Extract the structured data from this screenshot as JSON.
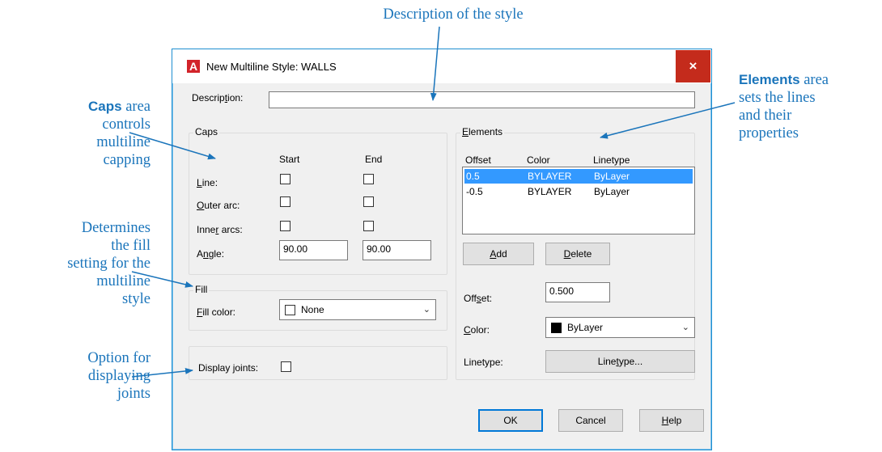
{
  "annotations": {
    "top": "Description of the style",
    "caps_bold": "Caps",
    "caps_rest_1": " area",
    "caps_rest_2": "controls",
    "caps_rest_3": "multiline",
    "caps_rest_4": "capping",
    "fill_1": "Determines",
    "fill_2": "the fill",
    "fill_3": "setting for the",
    "fill_4": "multiline",
    "fill_5": "style",
    "joints_1": "Option for",
    "joints_2": "displaying",
    "joints_3": "joints",
    "elements_bold": "Elements",
    "elements_rest_1": " area",
    "elements_rest_2": "sets the lines",
    "elements_rest_3": "and their",
    "elements_rest_4": "properties"
  },
  "dialog": {
    "title": "New Multiline Style: WALLS",
    "app_icon": "A",
    "close_label": "×",
    "description_label_pre": "Descrip",
    "description_label_u": "t",
    "description_label_post": "ion:",
    "description_value": "",
    "caps": {
      "title": "Caps",
      "col_start": "Start",
      "col_end": "End",
      "line_u": "L",
      "line_rest": "ine:",
      "outer_u": "O",
      "outer_rest": "uter arc:",
      "inner_pre": "Inne",
      "inner_u": "r",
      "inner_post": " arcs:",
      "angle_pre": "A",
      "angle_u": "n",
      "angle_post": "gle:",
      "angle_start": "90.00",
      "angle_end": "90.00"
    },
    "fill": {
      "title": "Fill",
      "color_u": "F",
      "color_rest": "ill color:",
      "color_value": "None"
    },
    "joints_pre": "Display ",
    "joints_u": "j",
    "joints_post": "oints:",
    "elements": {
      "title_u": "E",
      "title_rest": "lements",
      "headers": [
        "Offset",
        "Color",
        "Linetype"
      ],
      "rows": [
        {
          "offset": "0.5",
          "color": "BYLAYER",
          "linetype": "ByLayer"
        },
        {
          "offset": "-0.5",
          "color": "BYLAYER",
          "linetype": "ByLayer"
        }
      ],
      "add_u": "A",
      "add_rest": "dd",
      "delete_u": "D",
      "delete_rest": "elete",
      "offset_pre": "Off",
      "offset_u": "s",
      "offset_post": "et:",
      "offset_value": "0.500",
      "color_u": "C",
      "color_rest": "olor:",
      "color_value": "ByLayer",
      "linetype_label": "Linetype:",
      "linetype_btn_pre": "Line",
      "linetype_btn_u": "t",
      "linetype_btn_post": "ype..."
    },
    "ok": "OK",
    "cancel": "Cancel",
    "help_u": "H",
    "help_rest": "elp"
  },
  "colors": {
    "callout": "#1b75bb",
    "close": "#c42b1c",
    "selection": "#3399ff"
  }
}
